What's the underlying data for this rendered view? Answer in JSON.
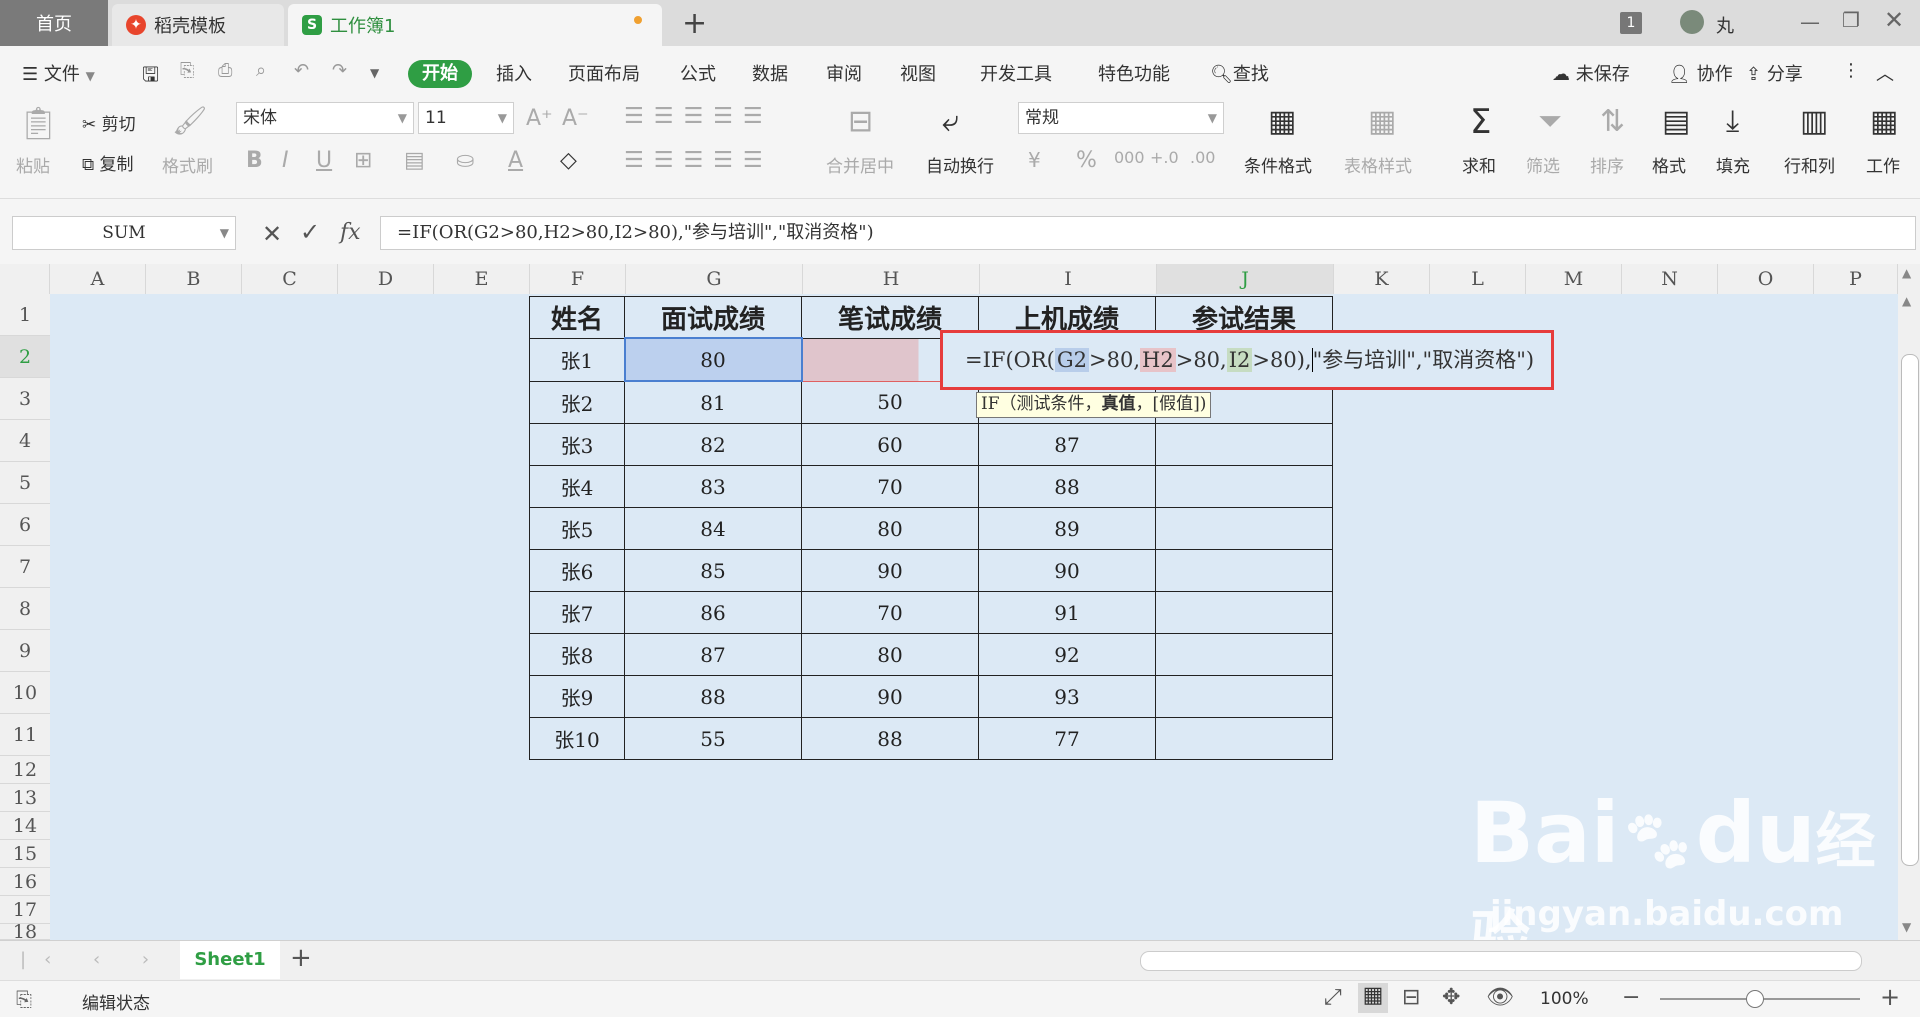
{
  "tabs": {
    "home": "首页",
    "daoke": "稻壳模板",
    "book": "工作簿1",
    "new_tab": "+"
  },
  "titlebar": {
    "count_badge": "1",
    "user": "丸"
  },
  "menu": {
    "file": "文件",
    "start": "开始",
    "insert": "插入",
    "page_layout": "页面布局",
    "formula": "公式",
    "data": "数据",
    "review": "审阅",
    "view": "视图",
    "developer": "开发工具",
    "special": "特色功能",
    "find": "查找",
    "unsaved": "未保存",
    "collab": "协作",
    "share": "分享"
  },
  "ribbon": {
    "paste": "粘贴",
    "cut": "剪切",
    "copy": "复制",
    "format_painter": "格式刷",
    "font_name": "宋体",
    "font_size": "11",
    "merge_center": "合并居中",
    "wrap_text": "自动换行",
    "number_format": "常规",
    "cond_format": "条件格式",
    "table_style": "表格样式",
    "sum": "求和",
    "filter": "筛选",
    "sort": "排序",
    "format": "格式",
    "fill": "填充",
    "row_col": "行和列",
    "worksheet": "工作"
  },
  "formula_bar": {
    "name_box": "SUM",
    "fx": "fx",
    "formula": "=IF(OR(G2>80,H2>80,I2>80),\"参与培训\",\"取消资格\")"
  },
  "columns": [
    "A",
    "B",
    "C",
    "D",
    "E",
    "F",
    "G",
    "H",
    "I",
    "J",
    "K",
    "L",
    "M",
    "N",
    "O",
    "P"
  ],
  "rows": [
    "1",
    "2",
    "3",
    "4",
    "5",
    "6",
    "7",
    "8",
    "9",
    "10",
    "11",
    "12",
    "13",
    "14",
    "15",
    "16",
    "17",
    "18"
  ],
  "table": {
    "headers": [
      "姓名",
      "面试成绩",
      "笔试成绩",
      "上机成绩",
      "参试结果"
    ],
    "rows": [
      [
        "张1",
        "80",
        "",
        "",
        ""
      ],
      [
        "张2",
        "81",
        "50",
        "",
        ""
      ],
      [
        "张3",
        "82",
        "60",
        "87",
        ""
      ],
      [
        "张4",
        "83",
        "70",
        "88",
        ""
      ],
      [
        "张5",
        "84",
        "80",
        "89",
        ""
      ],
      [
        "张6",
        "85",
        "90",
        "90",
        ""
      ],
      [
        "张7",
        "86",
        "70",
        "91",
        ""
      ],
      [
        "张8",
        "87",
        "80",
        "92",
        ""
      ],
      [
        "张9",
        "88",
        "90",
        "93",
        ""
      ],
      [
        "张10",
        "55",
        "88",
        "77",
        ""
      ]
    ]
  },
  "edit_cell": {
    "prefix": "=IF(OR(",
    "ref_g": "G2",
    "gt1": ">80,",
    "ref_h": "H2",
    "gt2": ">80,",
    "ref_i": "I2",
    "gt3": ">80),",
    "rest": "\"参与培训\",\"取消资格\")"
  },
  "tooltip": {
    "func": "IF",
    "arg1": "（测试条件，",
    "arg2": "真值",
    "arg3": "，[假值])"
  },
  "sheet": {
    "name": "Sheet1",
    "add": "+"
  },
  "status": {
    "mode": "编辑状态",
    "zoom": "100%"
  },
  "watermark": {
    "brand": "Bai",
    "brand2": "du",
    "jingyan": "经验",
    "url": "jingyan.baidu.com"
  }
}
